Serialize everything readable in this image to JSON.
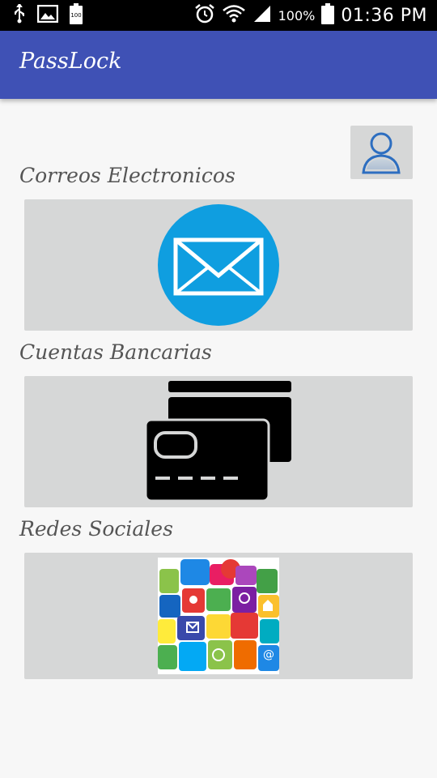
{
  "statusbar": {
    "battery_percent": "100%",
    "time": "01:36 PM",
    "icons": [
      "usb-icon",
      "image-icon",
      "battery-small-icon",
      "alarm-icon",
      "wifi-icon",
      "signal-icon",
      "battery-icon"
    ]
  },
  "appbar": {
    "title": "PassLock",
    "color": "#3f51b5"
  },
  "profile_button": {
    "icon": "user-icon"
  },
  "sections": [
    {
      "label": "Correos Electronicos",
      "icon": "email-icon"
    },
    {
      "label": "Cuentas Bancarias",
      "icon": "credit-card-icon"
    },
    {
      "label": "Redes Sociales",
      "icon": "social-media-collage-icon"
    }
  ],
  "colors": {
    "card_bg": "#d6d7d7",
    "email_blue": "#0f9ee0"
  }
}
